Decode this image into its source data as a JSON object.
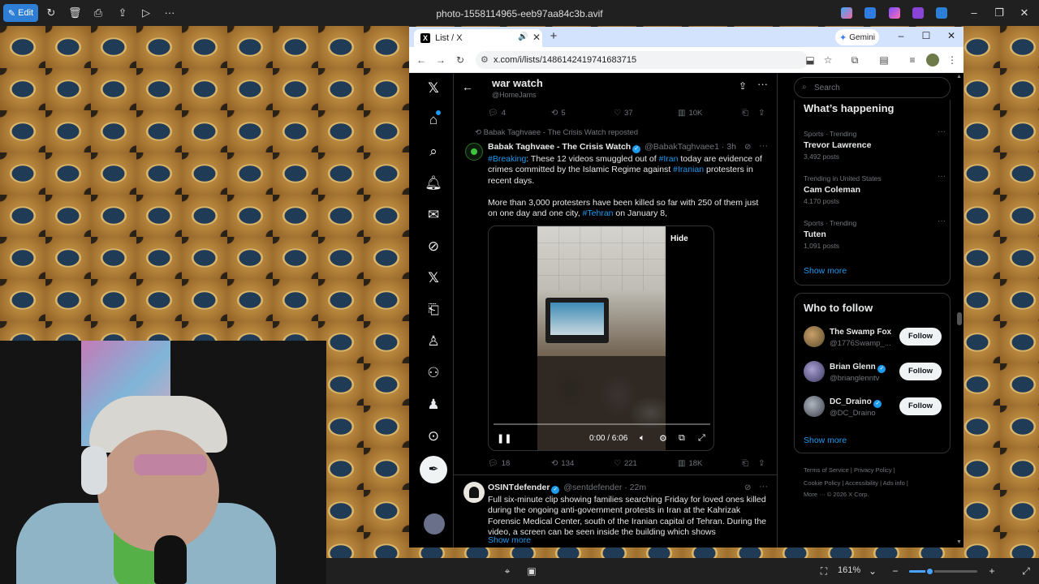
{
  "viewer": {
    "edit_label": "Edit",
    "filename": "photo-1558114965-eeb97aa84c3b.avif",
    "zoom": "161%",
    "zoom_level": 0.3
  },
  "browser": {
    "tab_title": "List / X",
    "tab_favicon": "X",
    "gemini_label": "Gemini",
    "url": "x.com/i/lists/1486142419741683715"
  },
  "list": {
    "title": "war watch",
    "subtitle": "@HomeJams"
  },
  "prev_actions": {
    "replies": "4",
    "reposts": "5",
    "likes": "37",
    "views": "10K"
  },
  "post1": {
    "repost_line": "Babak Taghvaee - The Crisis Watch reposted",
    "name": "Babak Taghvaee - The Crisis Watch",
    "handle": "@BabakTaghvaee1",
    "time": "· 3h",
    "line1_hash1": "#Breaking",
    "line1_a": ": These 12 videos smuggled out of ",
    "line1_hash2": "#Iran",
    "line1_b": " today are evidence of",
    "line2_a": "crimes committed by the Islamic Regime against ",
    "line2_hash": "#Iranian",
    "line2_b": " protesters in",
    "line3": "recent days.",
    "line4": "More than 3,000 protesters have been killed so far with 250 of them just",
    "line5_a": "on one day and one city, ",
    "line5_hash": "#Tehran",
    "line5_b": " on January 8,",
    "hide": "Hide",
    "video_time": "0:00 / 6:06",
    "replies": "18",
    "reposts": "134",
    "likes": "221",
    "views": "18K"
  },
  "post2": {
    "name": "OSINTdefender",
    "handle": "@sentdefender",
    "time": "· 22m",
    "lines": [
      "Full six-minute clip showing families searching Friday for loved ones killed",
      "during the ongoing anti-government protests in Iran at the Kahrizak",
      "Forensic Medical Center, south of the Iranian capital of Tehran. During the",
      "video, a screen can be seen inside the building which shows"
    ],
    "show_more": "Show more"
  },
  "sidebar": {
    "search_placeholder": "Search",
    "happening_title": "What’s happening",
    "trends": [
      {
        "context": "Sports · Trending",
        "name": "Trevor Lawrence",
        "count": "3,492 posts"
      },
      {
        "context": "Trending in United States",
        "name": "Cam Coleman",
        "count": "4,170 posts"
      },
      {
        "context": "Sports · Trending",
        "name": "Tuten",
        "count": "1,091 posts"
      }
    ],
    "show_more": "Show more",
    "who_title": "Who to follow",
    "follow_label": "Follow",
    "who": [
      {
        "name": "The Swamp Fox",
        "handle": "@1776Swamp_...",
        "verified": false
      },
      {
        "name": "Brian Glenn",
        "handle": "@brianglenntv",
        "verified": true
      },
      {
        "name": "DC_Draino",
        "handle": "@DC_Draino",
        "verified": true
      }
    ],
    "footer_line1": "Terms of Service  |  Privacy Policy  |",
    "footer_line2": "Cookie Policy  |  Accessibility  |  Ads info  |",
    "footer_line3": "More ···  © 2026 X Corp."
  },
  "colors": {
    "accent": "#1d9bf0",
    "edit_button": "#2e7ed6",
    "tab_strip": "#d3e3fd"
  }
}
